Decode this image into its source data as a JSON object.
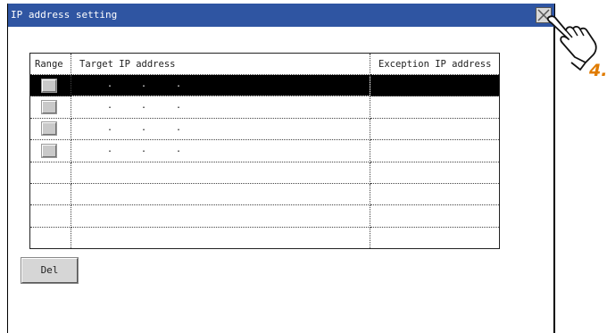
{
  "window": {
    "title": "IP address setting",
    "close_icon": "close-x-icon"
  },
  "table": {
    "headers": {
      "range": "Range",
      "target": "Target IP address",
      "exception": "Exception IP address"
    },
    "rows": [
      {
        "selected": true,
        "has_button": true,
        "ip_dots": true
      },
      {
        "selected": false,
        "has_button": true,
        "ip_dots": true
      },
      {
        "selected": false,
        "has_button": true,
        "ip_dots": true
      },
      {
        "selected": false,
        "has_button": true,
        "ip_dots": true
      },
      {
        "selected": false,
        "has_button": false,
        "ip_dots": false
      },
      {
        "selected": false,
        "has_button": false,
        "ip_dots": false
      },
      {
        "selected": false,
        "has_button": false,
        "ip_dots": false
      },
      {
        "selected": false,
        "has_button": false,
        "ip_dots": false
      }
    ],
    "ip_separator": "."
  },
  "buttons": {
    "del_label": "Del"
  },
  "annotation": {
    "step_label": "4.",
    "pointer_icon": "hand-pointer-icon",
    "color": "#e07b00"
  },
  "colors": {
    "titlebar": "#2f55a2",
    "selected_row": "#000000"
  }
}
